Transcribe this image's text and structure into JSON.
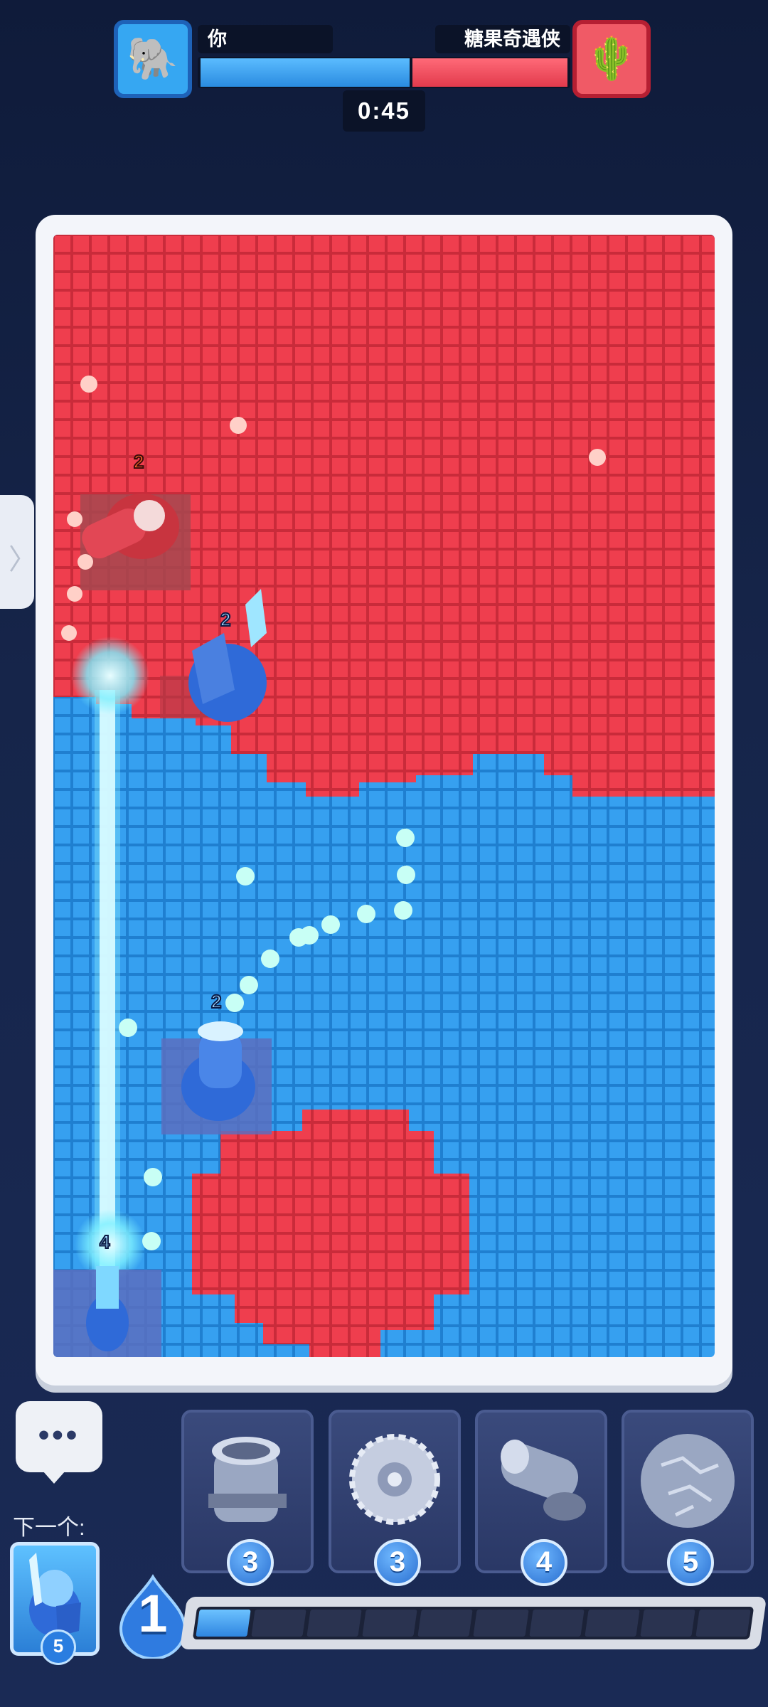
{
  "header": {
    "player_name": "你",
    "opponent_name": "糖果奇遇侠",
    "timer": "0:45",
    "player_share": 0.57,
    "colors": {
      "player": "#36a0f0",
      "opponent": "#ef3e4e"
    }
  },
  "board": {
    "units": [
      {
        "team": "red",
        "type": "cannon",
        "level": "2"
      },
      {
        "team": "blue",
        "type": "knight",
        "level": "2"
      },
      {
        "team": "blue",
        "type": "cannon",
        "level": "2"
      },
      {
        "team": "blue",
        "type": "laser",
        "level": "4"
      }
    ]
  },
  "side_tab": {
    "icon": "chevron-right-icon"
  },
  "bottom": {
    "chat_icon": "chat-bubble-icon",
    "next_label": "下一个:",
    "next_card": {
      "name": "knight-card",
      "cost": "5"
    },
    "cards": [
      {
        "name": "mortar",
        "cost": "3",
        "icon": "mortar-icon"
      },
      {
        "name": "saw-blade",
        "cost": "3",
        "icon": "saw-blade-icon"
      },
      {
        "name": "cannon",
        "cost": "4",
        "icon": "cannon-icon"
      },
      {
        "name": "boulder",
        "cost": "5",
        "icon": "boulder-icon"
      }
    ],
    "elixir": {
      "count": "1",
      "segments": 10,
      "filled": 1
    }
  }
}
